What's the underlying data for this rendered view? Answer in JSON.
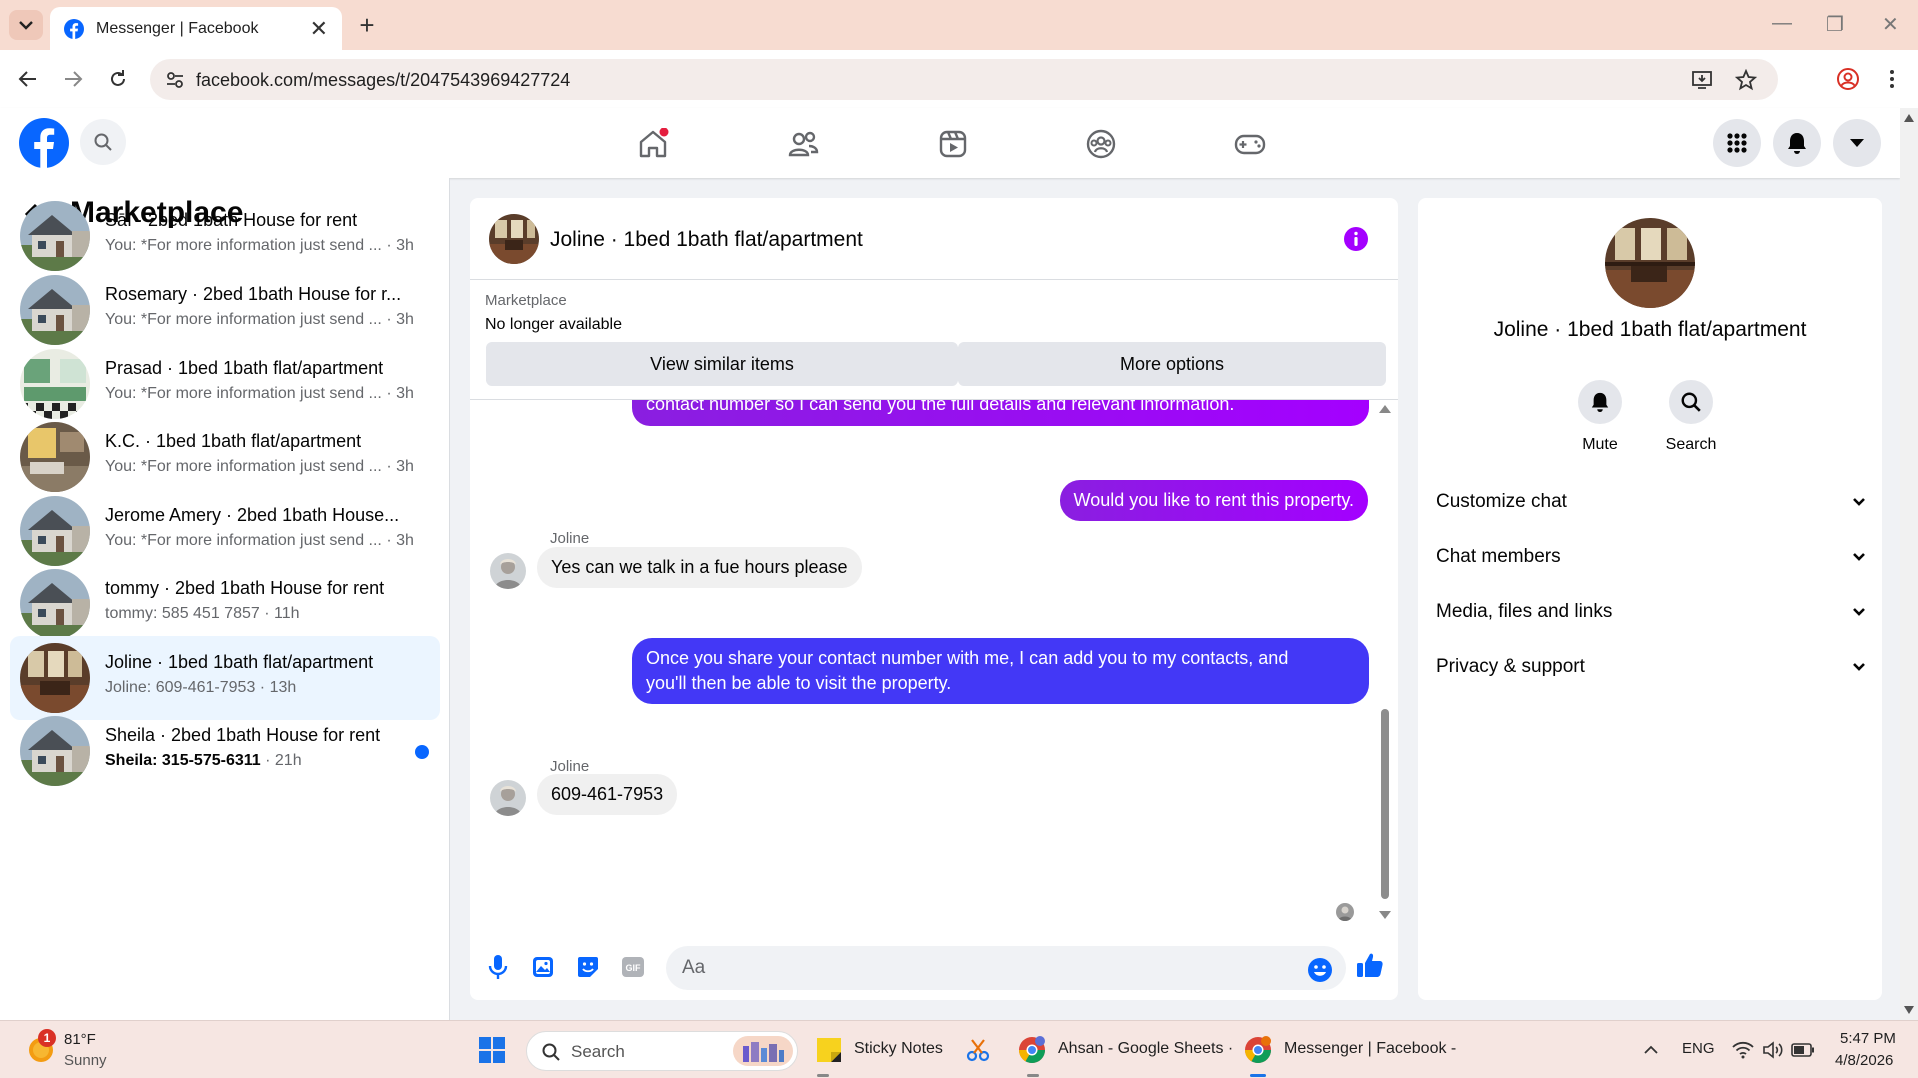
{
  "browser": {
    "tab_title": "Messenger | Facebook",
    "url": "facebook.com/messages/t/2047543969427724"
  },
  "sidebar": {
    "title": "Marketplace",
    "conversations": [
      {
        "name": "Sāï · 2bed 1bath House for rent",
        "preview": "You: *For more information just send ...",
        "time": "3h",
        "thumb": "house"
      },
      {
        "name": "Rosemary · 2bed 1bath House for r...",
        "preview": "You: *For more information just send ...",
        "time": "3h",
        "thumb": "house"
      },
      {
        "name": "Prasad · 1bed 1bath flat/apartment",
        "preview": "You: *For more information just send ...",
        "time": "3h",
        "thumb": "kitchen"
      },
      {
        "name": "K.C. · 1bed 1bath flat/apartment",
        "preview": "You: *For more information just send ...",
        "time": "3h",
        "thumb": "interior"
      },
      {
        "name": "Jerome Amery · 2bed 1bath House...",
        "preview": "You: *For more information just send ...",
        "time": "3h",
        "thumb": "house"
      },
      {
        "name": "tommy · 2bed 1bath House for rent",
        "preview": "tommy: 585 451 7857",
        "time": "11h",
        "thumb": "house"
      },
      {
        "name": "Joline · 1bed 1bath flat/apartment",
        "preview": "Joline: 609-461-7953",
        "time": "13h",
        "thumb": "room",
        "active": true
      },
      {
        "name": "Sheila · 2bed 1bath House for rent",
        "preview": "Sheila: 315-575-6311",
        "time": "21h",
        "thumb": "house",
        "unread": true
      }
    ]
  },
  "chat": {
    "title": "Joline · 1bed 1bath flat/apartment",
    "marketplace_label": "Marketplace",
    "listing_status": "No longer available",
    "view_similar_label": "View similar items",
    "more_options_label": "More options",
    "messages": [
      {
        "from": "me",
        "text": "contact number so I can send you the full details and relevant information."
      },
      {
        "from": "me",
        "text": "Would you like to rent this property."
      },
      {
        "from": "Joline",
        "sender_label": "Joline",
        "text": "Yes can we talk in a fue hours please"
      },
      {
        "from": "me",
        "text_line1": "Once you share your contact number with me, I can add you to my contacts, and",
        "text_line2": "you'll then be able to visit the property."
      },
      {
        "from": "Joline",
        "sender_label": "Joline",
        "text": "609-461-7953"
      }
    ],
    "composer_placeholder": "Aa"
  },
  "details": {
    "title": "Joline · 1bed 1bath flat/apartment",
    "mute_label": "Mute",
    "search_label": "Search",
    "sections": [
      "Customize chat",
      "Chat members",
      "Media, files and links",
      "Privacy & support"
    ]
  },
  "taskbar": {
    "weather_badge": "1",
    "temperature": "81°F",
    "condition": "Sunny",
    "search_label": "Search",
    "apps": [
      "Sticky Notes",
      "Ahsan - Google Sheets ·",
      "Messenger | Facebook -"
    ],
    "language": "ENG",
    "time": "5:47 PM",
    "date": "4/8/2026"
  },
  "colors": {
    "fb_blue": "#0866ff",
    "bubble_purple": "#a400ff",
    "bubble_indigo": "#4338f6",
    "info_purple": "#a400ff"
  }
}
